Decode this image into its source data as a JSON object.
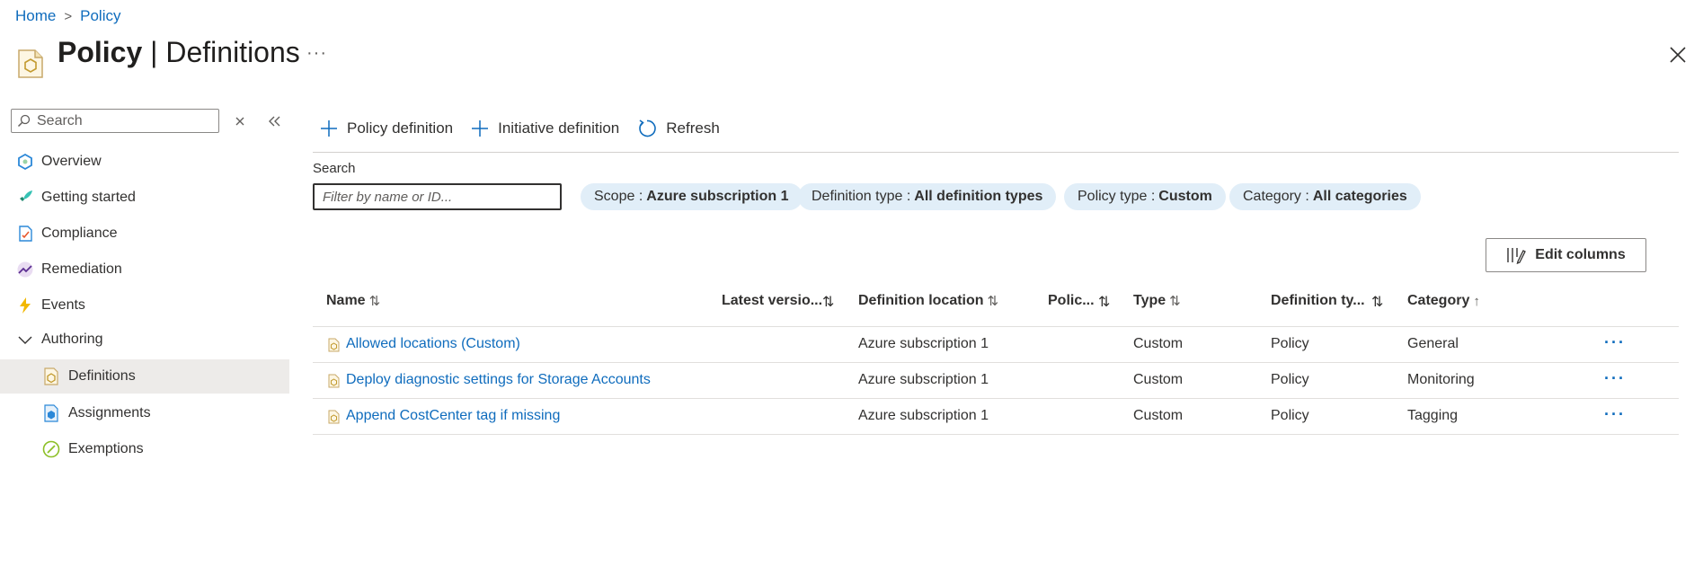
{
  "breadcrumb": {
    "home": "Home",
    "policy": "Policy",
    "separator": ">"
  },
  "header": {
    "title_bold": "Policy",
    "title_separator": " | ",
    "title_rest": "Definitions",
    "more": "···"
  },
  "sidebar": {
    "search_placeholder": "Search",
    "items": [
      {
        "label": "Overview",
        "icon": "overview-icon"
      },
      {
        "label": "Getting started",
        "icon": "rocket-icon"
      },
      {
        "label": "Compliance",
        "icon": "compliance-icon"
      },
      {
        "label": "Remediation",
        "icon": "remediation-icon"
      },
      {
        "label": "Events",
        "icon": "lightning-icon"
      },
      {
        "label": "Authoring",
        "icon": "chevron-down-icon"
      },
      {
        "label": "Definitions",
        "icon": "definition-icon",
        "selected": true
      },
      {
        "label": "Assignments",
        "icon": "assignment-icon"
      },
      {
        "label": "Exemptions",
        "icon": "exemption-icon"
      }
    ]
  },
  "toolbar": {
    "policy_definition": "Policy definition",
    "initiative_definition": "Initiative definition",
    "refresh": "Refresh"
  },
  "filters": {
    "search_label": "Search",
    "search_placeholder": "Filter by name or ID...",
    "pills": [
      {
        "key": "Scope :",
        "value": "Azure subscription 1"
      },
      {
        "key": "Definition type :",
        "value": "All definition types"
      },
      {
        "key": "Policy type :",
        "value": "Custom"
      },
      {
        "key": "Category :",
        "value": "All categories"
      }
    ]
  },
  "edit_columns": "Edit columns",
  "table": {
    "columns": [
      "Name",
      "Latest versio...",
      "Definition location",
      "Polic...",
      "Type",
      "Definition ty...",
      "Category"
    ],
    "sort_glyph": "⇅",
    "sorted_glyph": "↑",
    "rows": [
      {
        "name": "Allowed locations (Custom)",
        "version": "",
        "location": "Azure subscription 1",
        "policy": "",
        "type": "Custom",
        "def_type": "Policy",
        "category": "General"
      },
      {
        "name": "Deploy diagnostic settings for Storage Accounts",
        "version": "",
        "location": "Azure subscription 1",
        "policy": "",
        "type": "Custom",
        "def_type": "Policy",
        "category": "Monitoring"
      },
      {
        "name": "Append CostCenter tag if missing",
        "version": "",
        "location": "Azure subscription 1",
        "policy": "",
        "type": "Custom",
        "def_type": "Policy",
        "category": "Tagging"
      }
    ],
    "row_more": "···"
  },
  "colors": {
    "link": "#0f6cbd",
    "pill_bg": "#e1eef8",
    "selected_bg": "#edebe9",
    "text": "#323130"
  }
}
